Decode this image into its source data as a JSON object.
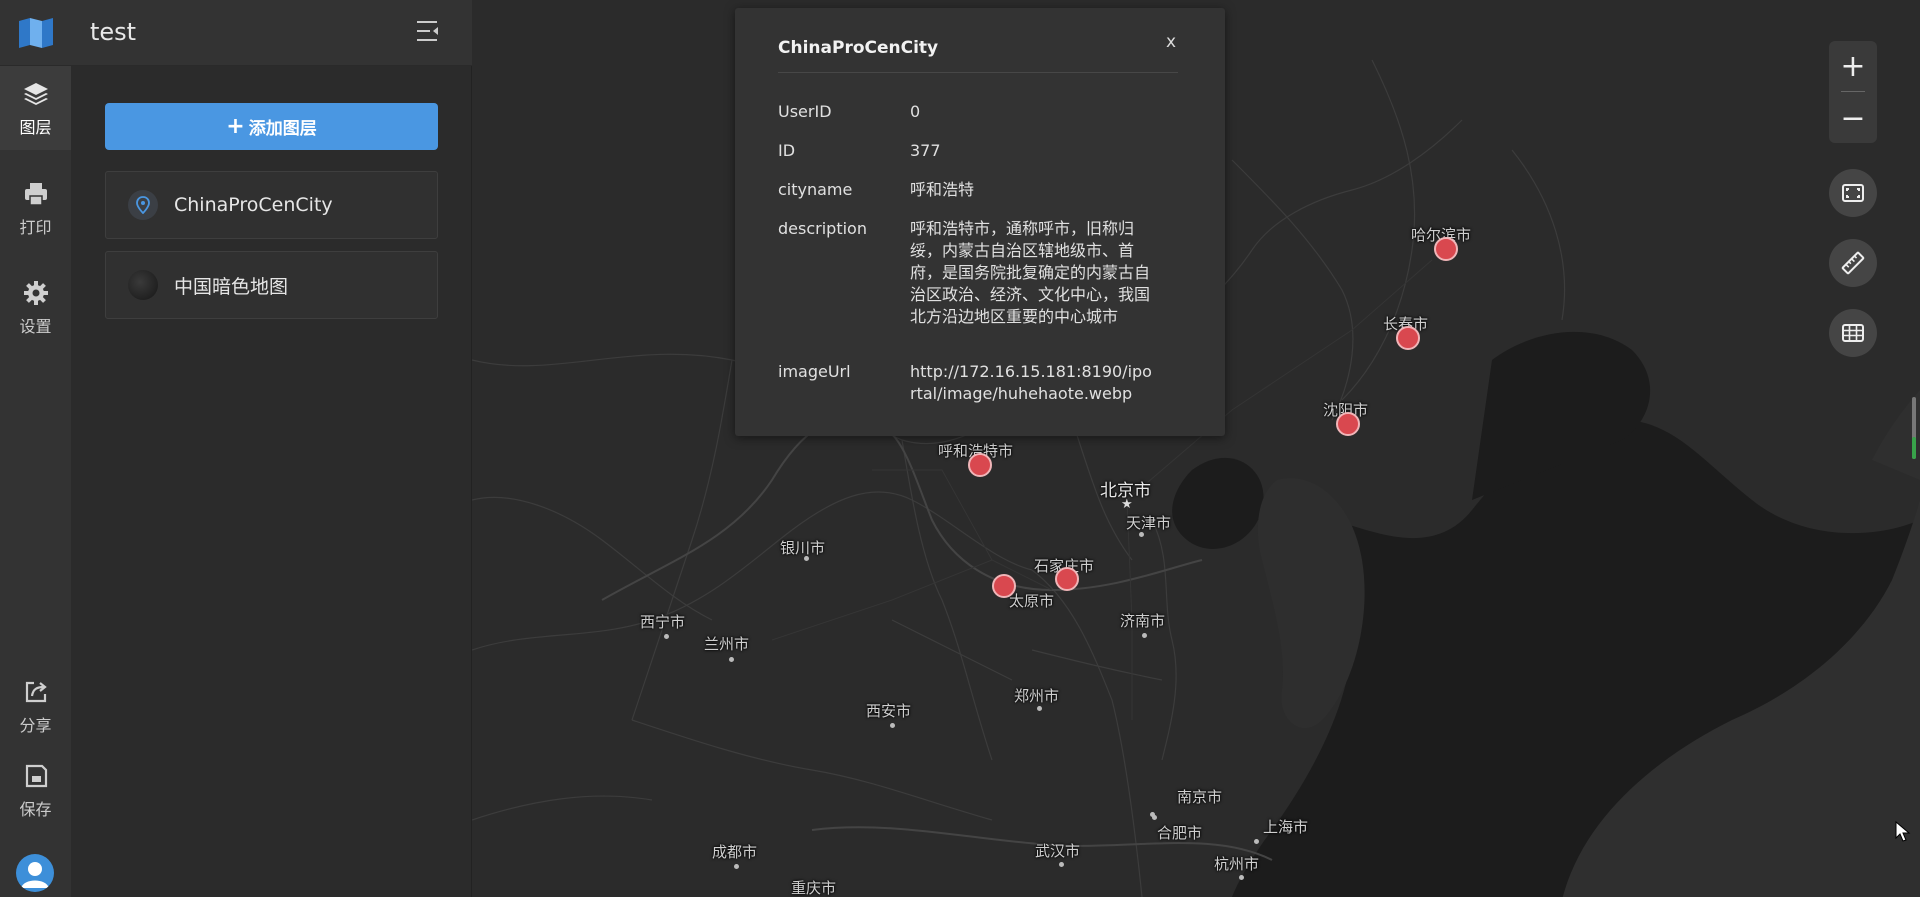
{
  "app": {
    "title": "test"
  },
  "rail": {
    "items": [
      {
        "label": "图层",
        "icon": "layers-icon"
      },
      {
        "label": "打印",
        "icon": "printer-icon"
      },
      {
        "label": "设置",
        "icon": "gear-icon"
      },
      {
        "label": "分享",
        "icon": "share-icon"
      },
      {
        "label": "保存",
        "icon": "save-icon"
      }
    ]
  },
  "panel": {
    "add_button": "添加图层",
    "layers": [
      {
        "name": "ChinaProCenCity",
        "icon": "map-pin-icon"
      },
      {
        "name": "中国暗色地图",
        "icon": "basemap-thumbnail"
      }
    ]
  },
  "popup": {
    "title": "ChinaProCenCity",
    "close": "x",
    "rows": [
      {
        "key": "UserID",
        "value": "0"
      },
      {
        "key": "ID",
        "value": "377"
      },
      {
        "key": "cityname",
        "value": "呼和浩特"
      },
      {
        "key": "description",
        "value": "呼和浩特市，通称呼市，旧称归绥，内蒙古自治区辖地级市、首府，是国务院批复确定的内蒙古自治区政治、经济、文化中心，我国北方沿边地区重要的中心城市"
      },
      {
        "key": "imageUrl",
        "value": "http://172.16.15.181:8190/iportal/image/huhehaote.webp"
      }
    ]
  },
  "map": {
    "cities": [
      {
        "name": "哈尔滨市"
      },
      {
        "name": "长春市"
      },
      {
        "name": "沈阳市"
      },
      {
        "name": "呼和浩特市"
      },
      {
        "name": "北京市"
      },
      {
        "name": "天津市"
      },
      {
        "name": "石家庄市"
      },
      {
        "name": "太原市"
      },
      {
        "name": "银川市"
      },
      {
        "name": "西宁市"
      },
      {
        "name": "兰州市"
      },
      {
        "name": "济南市"
      },
      {
        "name": "西安市"
      },
      {
        "name": "郑州市"
      },
      {
        "name": "南京市"
      },
      {
        "name": "合肥市"
      },
      {
        "name": "上海市"
      },
      {
        "name": "杭州市"
      },
      {
        "name": "成都市"
      },
      {
        "name": "武汉市"
      },
      {
        "name": "重庆市"
      }
    ],
    "controls": {
      "zoom_in": "+",
      "zoom_out": "−"
    },
    "colors": {
      "marker": "#d9484f",
      "land": "#2e2e2e",
      "sea": "#1b1b1b",
      "accent": "#4a97e2"
    }
  }
}
